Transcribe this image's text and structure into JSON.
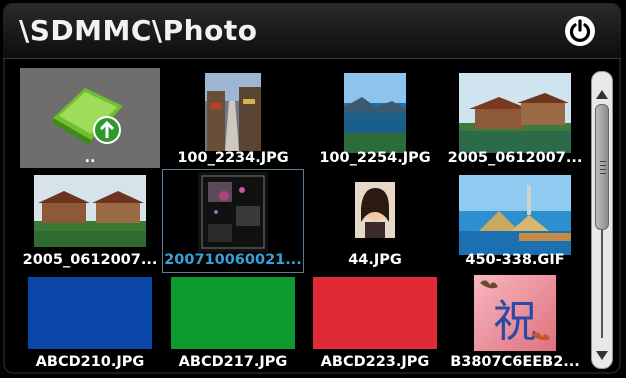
{
  "header": {
    "title": "\\SDMMC\\Photo",
    "power_icon": "power-icon"
  },
  "items": [
    {
      "label": "..",
      "kind": "folder-up"
    },
    {
      "label": "100_2234.JPG",
      "kind": "photo-street"
    },
    {
      "label": "100_2254.JPG",
      "kind": "photo-lake"
    },
    {
      "label": "2005_0612007...",
      "kind": "photo-houses"
    },
    {
      "label": "2005_0612007...",
      "kind": "photo-houses2"
    },
    {
      "label": "200710060021...",
      "kind": "photo-dark",
      "selected": true
    },
    {
      "label": "44.JPG",
      "kind": "photo-portrait"
    },
    {
      "label": "450-338.GIF",
      "kind": "photo-tower"
    },
    {
      "label": "ABCD210.JPG",
      "kind": "solid",
      "color": "#0a45a8"
    },
    {
      "label": "ABCD217.JPG",
      "kind": "solid",
      "color": "#0a9a2e"
    },
    {
      "label": "ABCD223.JPG",
      "kind": "solid",
      "color": "#e02a36"
    },
    {
      "label": "B3807C6EEB2...",
      "kind": "photo-calligraphy",
      "glyph": "祝"
    }
  ],
  "colors": {
    "selected_label": "#3aa0d8",
    "selection_outline": "#5a7e98"
  }
}
